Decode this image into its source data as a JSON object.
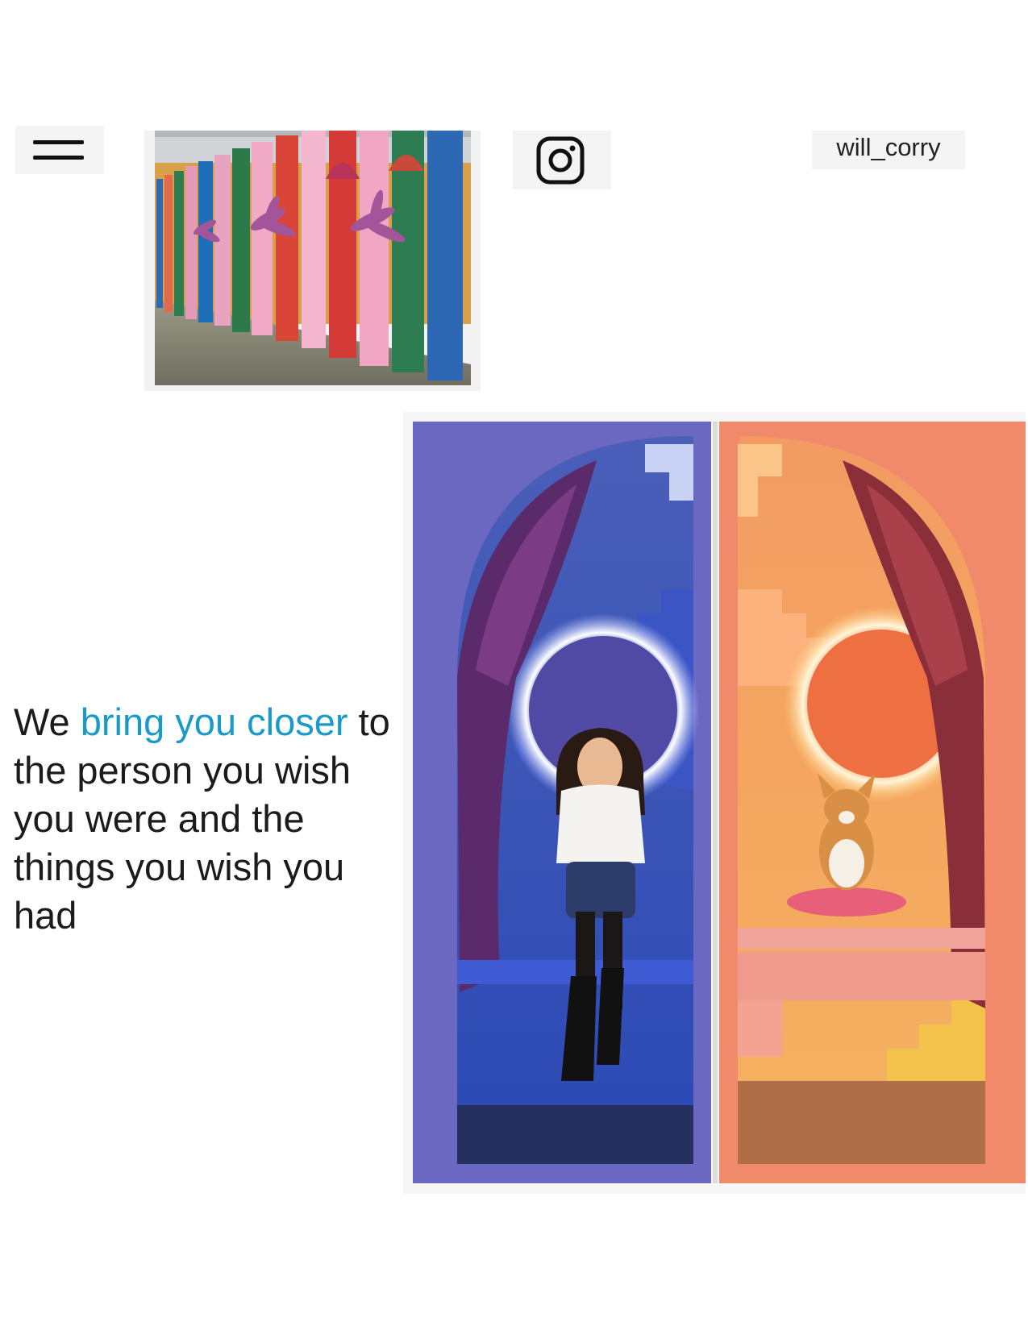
{
  "header": {
    "menu_icon": "hamburger-menu-icon",
    "instagram_icon": "instagram-icon",
    "instagram_handle": "will_corry"
  },
  "gallery": {
    "top_image_subject": "pillars-photo",
    "main_image_subject": "arch-booths-photo"
  },
  "tagline": {
    "lead": "We",
    "highlight": "bring you closer",
    "rest": "to the person you wish you were and the things you wish you had",
    "accent_color": "#1a9ac9"
  }
}
